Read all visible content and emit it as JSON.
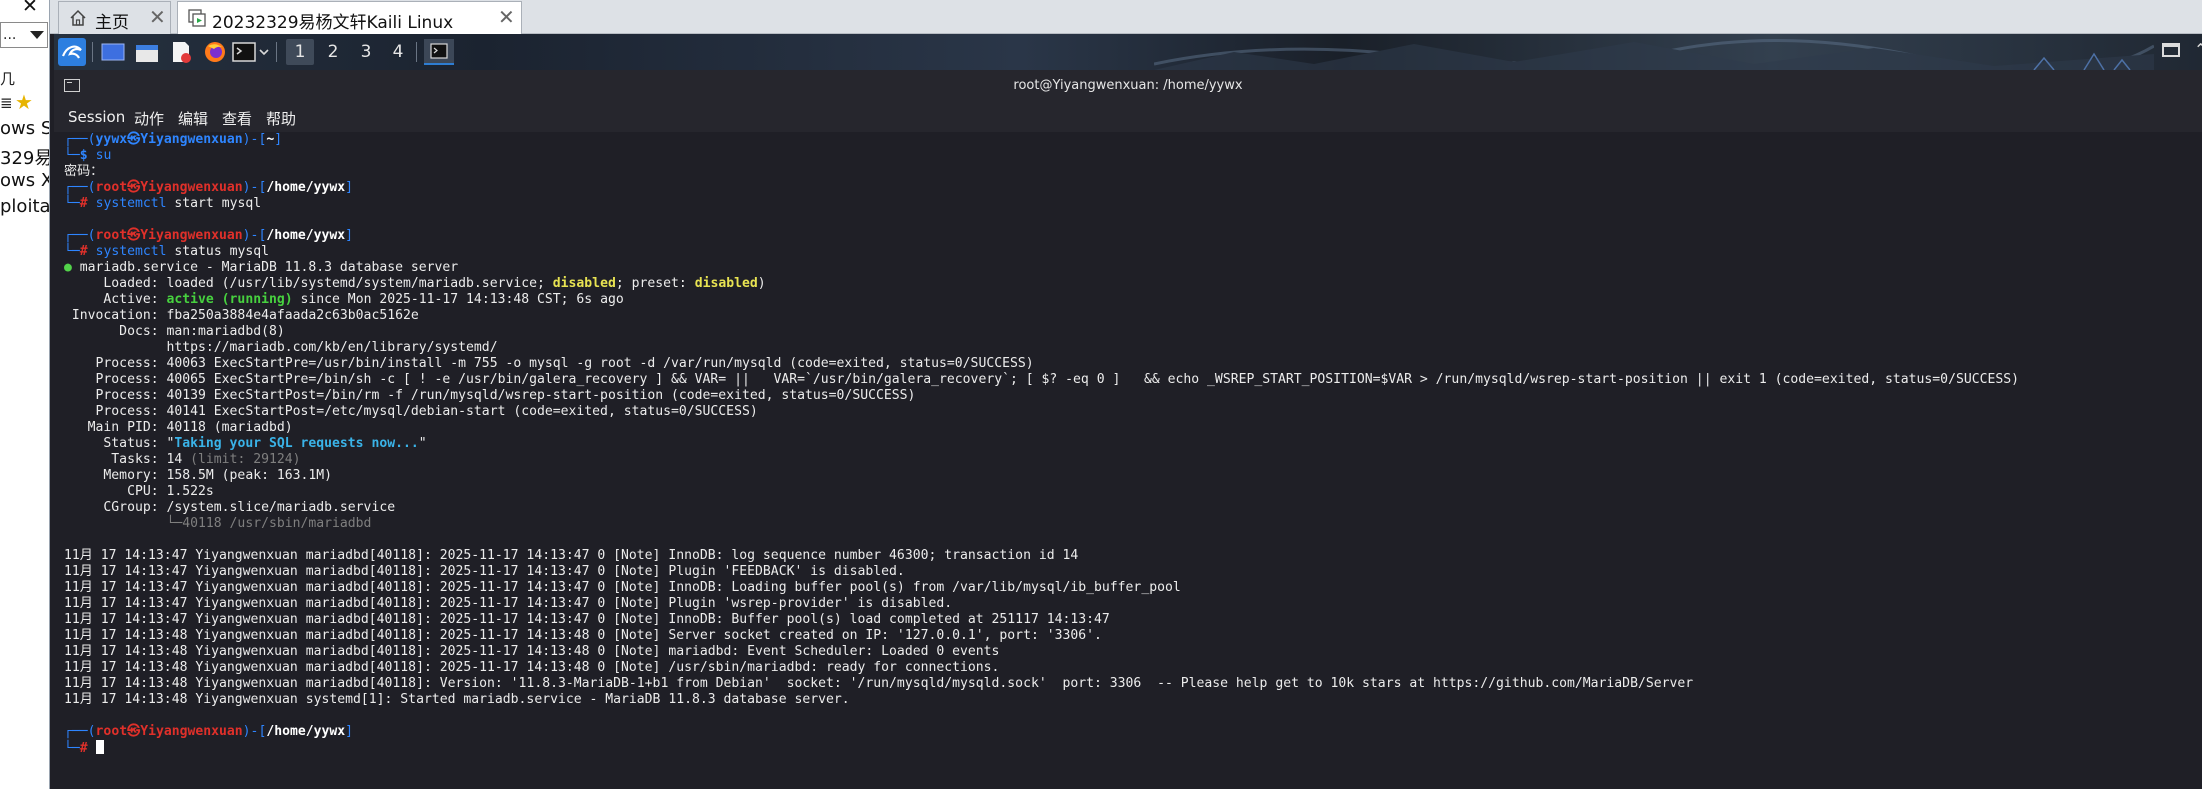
{
  "host_sidebar": {
    "close_glyph": "✕",
    "combo_text": "...",
    "nav_line_text": "几",
    "star_row_text": "≣",
    "list_items": [
      "ows Se",
      "329易",
      "ows XI",
      "ploita"
    ]
  },
  "vm_tabs": [
    {
      "label": "主页",
      "icon": "home-icon",
      "close": "✕"
    },
    {
      "label": "20232329易杨文轩Kaili Linux",
      "icon": "vm-icon",
      "close": "✕"
    }
  ],
  "xfce_panel": {
    "workspaces": [
      "1",
      "2",
      "3",
      "4"
    ],
    "launchers": [
      "kali-menu-icon",
      "desktop-icon",
      "file-manager-icon",
      "text-editor-icon",
      "firefox-icon",
      "terminal-icon"
    ]
  },
  "terminal": {
    "title": "root@Yiyangwenxuan: /home/yywx",
    "menus": [
      "Session",
      "动作",
      "编辑",
      "查看",
      "帮助"
    ],
    "prompt1": {
      "user": "yywx",
      "host": "Yiyangwenxuan",
      "dir": "~",
      "cmd": "su"
    },
    "password_prompt": "密码：",
    "prompt2": {
      "user": "root",
      "host": "Yiyangwenxuan",
      "dir": "/home/yywx",
      "cmd_word": "systemctl",
      "cmd_rest": " start mysql"
    },
    "prompt3": {
      "user": "root",
      "host": "Yiyangwenxuan",
      "dir": "/home/yywx",
      "cmd_word": "systemctl",
      "cmd_rest": " status mysql"
    },
    "status": {
      "dot": "●",
      "service_line": "mariadb.service - MariaDB 11.8.3 database server",
      "loaded_pre": "loaded (/usr/lib/systemd/system/mariadb.service; ",
      "loaded_disabled": "disabled",
      "loaded_mid": "; preset: ",
      "loaded_preset": "disabled",
      "loaded_post": ")",
      "active_state": "active (running)",
      "active_since": " since Mon 2025-11-17 14:13:48 CST; 6s ago",
      "invocation": "fba250a3884e4afaada2c63b0ac5162e",
      "docs1": "man:mariadbd(8)",
      "docs2": "https://mariadb.com/kb/en/library/systemd/",
      "process1": "40063 ExecStartPre=/usr/bin/install -m 755 -o mysql -g root -d /var/run/mysqld (code=exited, status=0/SUCCESS)",
      "process2": "40065 ExecStartPre=/bin/sh -c [ ! -e /usr/bin/galera_recovery ] && VAR= ||   VAR=`/usr/bin/galera_recovery`; [ $? -eq 0 ]   && echo _WSREP_START_POSITION=$VAR > /run/mysqld/wsrep-start-position || exit 1 (code=exited, status=0/SUCCESS)",
      "process3": "40139 ExecStartPost=/bin/rm -f /run/mysqld/wsrep-start-position (code=exited, status=0/SUCCESS)",
      "process4": "40141 ExecStartPost=/etc/mysql/debian-start (code=exited, status=0/SUCCESS)",
      "main_pid": "40118 (mariadbd)",
      "status_text": "Taking your SQL requests now...",
      "tasks": "14",
      "tasks_limit": " (limit: 29124)",
      "memory": "158.5M (peak: 163.1M)",
      "cpu": "1.522s",
      "cgroup": "/system.slice/mariadb.service",
      "cgroup_child": "└─40118 /usr/sbin/mariadbd"
    },
    "log_lines": [
      "11月 17 14:13:47 Yiyangwenxuan mariadbd[40118]: 2025-11-17 14:13:47 0 [Note] InnoDB: log sequence number 46300; transaction id 14",
      "11月 17 14:13:47 Yiyangwenxuan mariadbd[40118]: 2025-11-17 14:13:47 0 [Note] Plugin 'FEEDBACK' is disabled.",
      "11月 17 14:13:47 Yiyangwenxuan mariadbd[40118]: 2025-11-17 14:13:47 0 [Note] InnoDB: Loading buffer pool(s) from /var/lib/mysql/ib_buffer_pool",
      "11月 17 14:13:47 Yiyangwenxuan mariadbd[40118]: 2025-11-17 14:13:47 0 [Note] Plugin 'wsrep-provider' is disabled.",
      "11月 17 14:13:47 Yiyangwenxuan mariadbd[40118]: 2025-11-17 14:13:47 0 [Note] InnoDB: Buffer pool(s) load completed at 251117 14:13:47",
      "11月 17 14:13:48 Yiyangwenxuan mariadbd[40118]: 2025-11-17 14:13:48 0 [Note] Server socket created on IP: '127.0.0.1', port: '3306'.",
      "11月 17 14:13:48 Yiyangwenxuan mariadbd[40118]: 2025-11-17 14:13:48 0 [Note] mariadbd: Event Scheduler: Loaded 0 events",
      "11月 17 14:13:48 Yiyangwenxuan mariadbd[40118]: 2025-11-17 14:13:48 0 [Note] /usr/sbin/mariadbd: ready for connections.",
      "11月 17 14:13:48 Yiyangwenxuan mariadbd[40118]: Version: '11.8.3-MariaDB-1+b1 from Debian'  socket: '/run/mysqld/mysqld.sock'  port: 3306  -- Please help get to 10k stars at https://github.com/MariaDB/Server",
      "11月 17 14:13:48 Yiyangwenxuan systemd[1]: Started mariadb.service - MariaDB 11.8.3 database server."
    ],
    "prompt4": {
      "user": "root",
      "host": "Yiyangwenxuan",
      "dir": "/home/yywx"
    }
  },
  "colors": {
    "terminal_bg": "#1f1f26",
    "prompt_blue": "#2e85ff",
    "root_red": "#e0302a",
    "active_green": "#47d13f",
    "disabled_yellow": "#e8e352",
    "status_cyan": "#3ab3e8"
  }
}
